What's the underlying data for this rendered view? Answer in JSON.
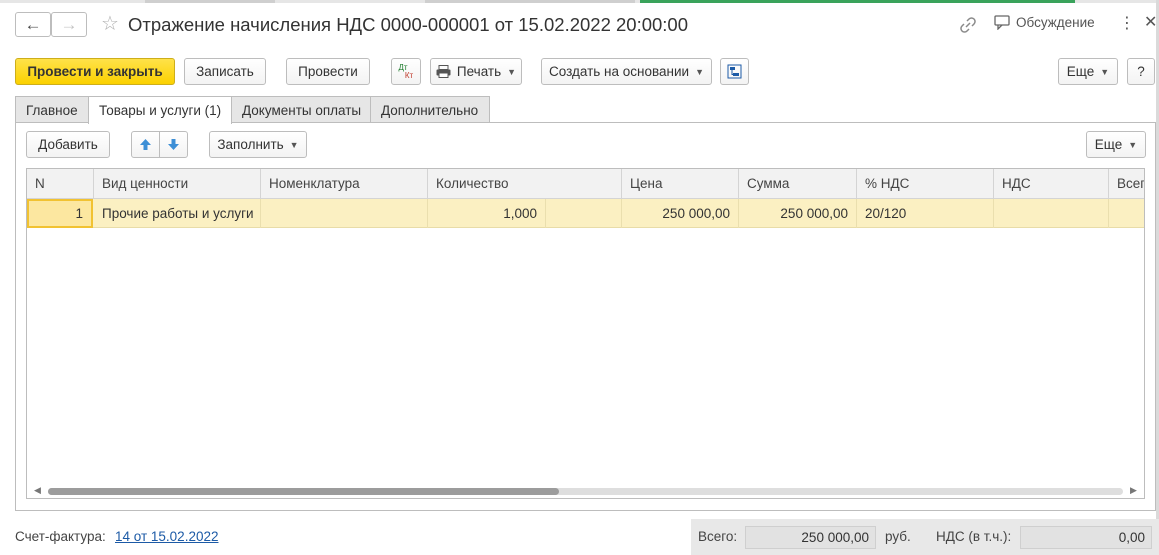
{
  "colors": {
    "accent_yellow": "#fbd100",
    "row_highlight": "#fbf0c2",
    "link": "#1c5aa6",
    "tab_strip_green": "#3aa35b"
  },
  "header": {
    "title": "Отражение начисления НДС 0000-000001 от 15.02.2022 20:00:00",
    "back_icon": "arrow-left-icon",
    "forward_icon": "arrow-right-icon",
    "favorite_icon": "star-icon",
    "link_icon": "link-icon",
    "discussion_label": "Обсуждение",
    "discussion_icon": "chat-icon",
    "more_icon": "kebab-icon",
    "close_icon": "close-icon"
  },
  "toolbar": {
    "post_and_close": "Провести и закрыть",
    "save": "Записать",
    "post": "Провести",
    "dt_kt_top": "Дт",
    "dt_kt_bottom": "Кт",
    "print": "Печать",
    "create_based_on": "Создать на основании",
    "more": "Еще",
    "help": "?"
  },
  "tabs": [
    {
      "label": "Главное",
      "active": false
    },
    {
      "label": "Товары и услуги (1)",
      "active": true
    },
    {
      "label": "Документы оплаты",
      "active": false
    },
    {
      "label": "Дополнительно",
      "active": false
    }
  ],
  "table_toolbar": {
    "add": "Добавить",
    "move_up_icon": "arrow-up-icon",
    "move_down_icon": "arrow-down-icon",
    "fill": "Заполнить",
    "more": "Еще"
  },
  "table": {
    "columns": [
      "N",
      "Вид ценности",
      "Номенклатура",
      "Количество",
      "",
      "Цена",
      "Сумма",
      "% НДС",
      "НДС",
      "Всего"
    ],
    "rows": [
      {
        "n": "1",
        "value_type": "Прочие работы и услуги",
        "nomenclature": "",
        "quantity": "1,000",
        "unit": "",
        "price": "250 000,00",
        "sum": "250 000,00",
        "vat_rate": "20/120",
        "vat": "",
        "total": ""
      }
    ],
    "scroll_position": 0.0
  },
  "footer": {
    "invoice_label": "Счет-фактура:",
    "invoice_link": "14 от 15.02.2022",
    "total_label": "Всего:",
    "total_value": "250 000,00",
    "currency": "руб.",
    "vat_label": "НДС (в т.ч.):",
    "vat_value": "0,00"
  }
}
